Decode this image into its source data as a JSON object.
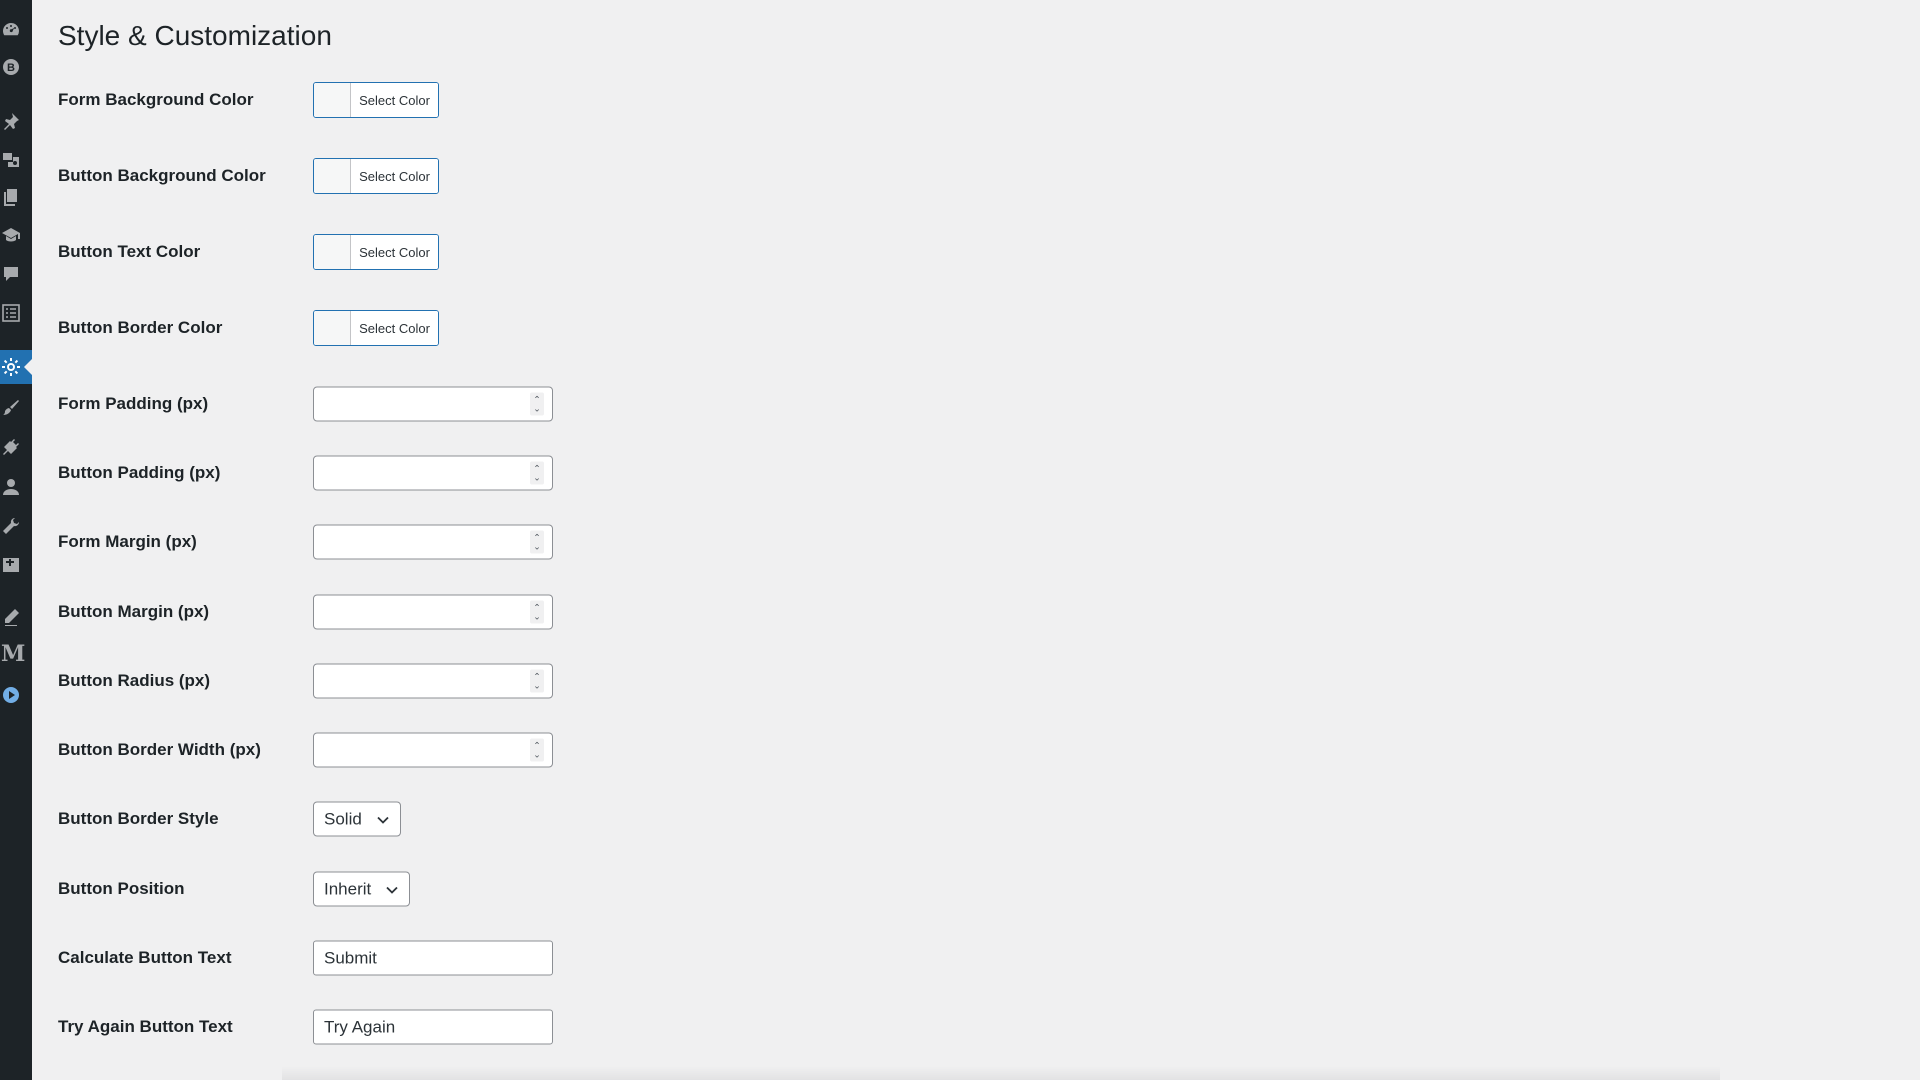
{
  "page": {
    "title": "Style & Customization"
  },
  "sidebar": {
    "icons": [
      "dashboard-icon",
      "b-badge-icon",
      "pin-icon",
      "media-icon",
      "pages-icon",
      "graduation-cap-icon",
      "comment-icon",
      "form-list-icon",
      "settings-gear-icon",
      "appearance-brush-icon",
      "plugins-icon",
      "users-icon",
      "tools-wrench-icon",
      "add-block-icon",
      "pencil-icon",
      "m-logo-icon",
      "play-circle-icon"
    ],
    "m_letter": "M",
    "active_icon": "settings-gear-icon"
  },
  "fields": {
    "form_bg_color": {
      "label": "Form Background Color",
      "button_text": "Select Color"
    },
    "button_bg_color": {
      "label": "Button Background Color",
      "button_text": "Select Color"
    },
    "button_text_color": {
      "label": "Button Text Color",
      "button_text": "Select Color"
    },
    "button_border_color": {
      "label": "Button Border Color",
      "button_text": "Select Color"
    },
    "form_padding": {
      "label": "Form Padding (px)",
      "value": ""
    },
    "button_padding": {
      "label": "Button Padding (px)",
      "value": ""
    },
    "form_margin": {
      "label": "Form Margin (px)",
      "value": ""
    },
    "button_margin": {
      "label": "Button Margin (px)",
      "value": ""
    },
    "button_radius": {
      "label": "Button Radius (px)",
      "value": ""
    },
    "button_border_width": {
      "label": "Button Border Width (px)",
      "value": ""
    },
    "button_border_style": {
      "label": "Button Border Style",
      "selected": "Solid"
    },
    "button_position": {
      "label": "Button Position",
      "selected": "Inherit"
    },
    "calculate_button_text": {
      "label": "Calculate Button Text",
      "value": "Submit"
    },
    "try_again_button_text": {
      "label": "Try Again Button Text",
      "value": "Try Again"
    }
  },
  "colors": {
    "sidebar_bg": "#1d2327",
    "page_bg": "#f0f0f1",
    "accent": "#2271b1"
  }
}
